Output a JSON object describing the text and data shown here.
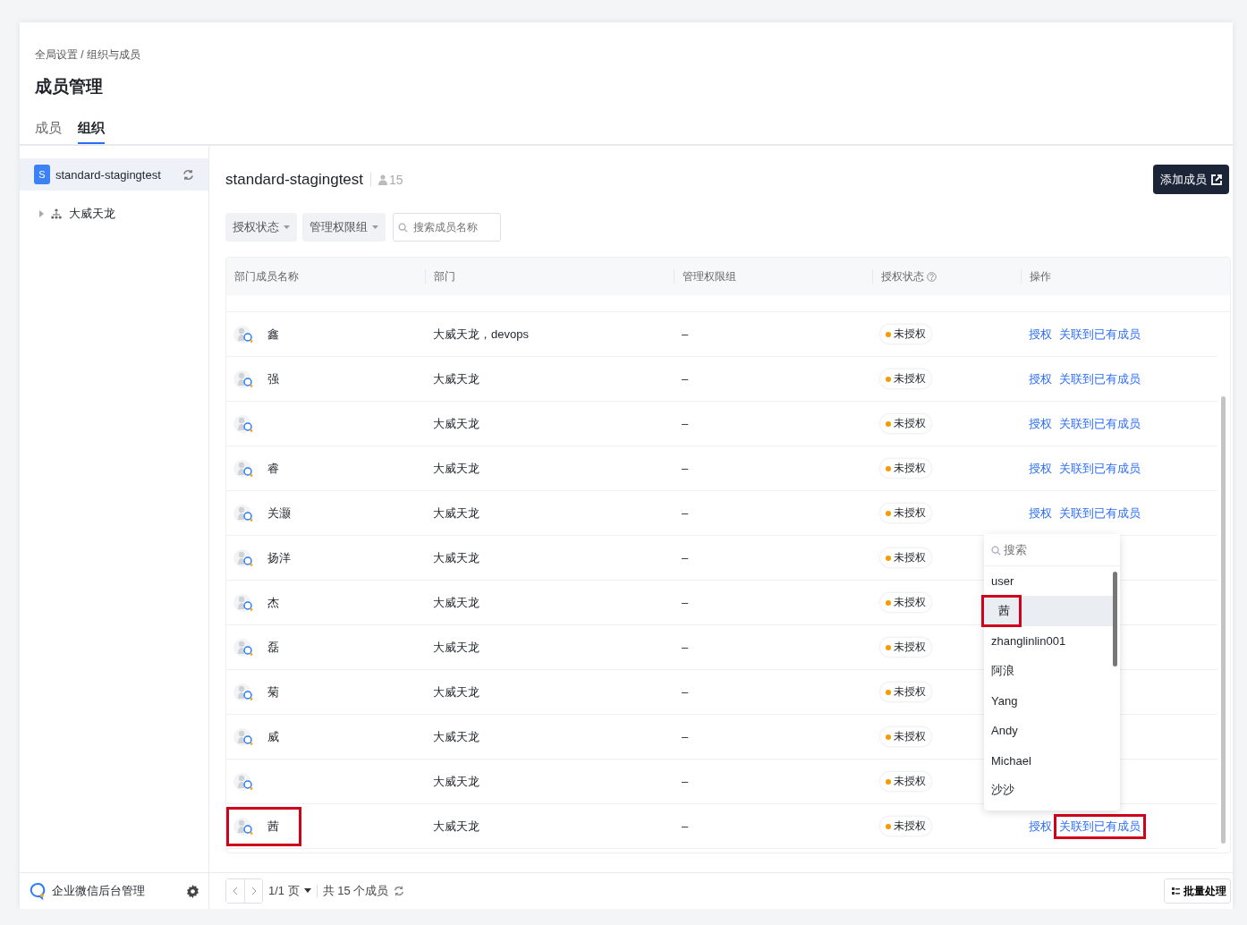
{
  "breadcrumb": "全局设置 / 组织与成员",
  "title": "成员管理",
  "tabs": [
    {
      "label": "成员",
      "selected": false
    },
    {
      "label": "组织",
      "selected": true
    }
  ],
  "sidebar": {
    "org": {
      "badge": "S",
      "name": "standard-stagingtest",
      "selected": true
    },
    "tree": [
      {
        "label": "大威天龙",
        "expanded": false
      }
    ],
    "footer_label": "企业微信后台管理"
  },
  "panel": {
    "title": "standard-stagingtest",
    "member_count": "15",
    "add_button": "添加成员",
    "filters": [
      {
        "label": "授权状态"
      },
      {
        "label": "管理权限组"
      }
    ],
    "search": {
      "placeholder": "搜索成员名称"
    }
  },
  "table": {
    "columns": [
      {
        "label": "部门成员名称",
        "help": false
      },
      {
        "label": "部门",
        "help": false
      },
      {
        "label": "管理权限组",
        "help": false
      },
      {
        "label": "授权状态",
        "help": true
      },
      {
        "label": "操作",
        "help": false
      }
    ],
    "rows": [
      {
        "name": "鑫",
        "department": "大威天龙，devops",
        "role": "–",
        "status": "未授权",
        "actions": [
          "授权",
          "关联到已有成员"
        ],
        "highlight_name": false,
        "highlight_action": false
      },
      {
        "name": "强",
        "department": "大威天龙",
        "role": "–",
        "status": "未授权",
        "actions": [
          "授权",
          "关联到已有成员"
        ],
        "highlight_name": false,
        "highlight_action": false
      },
      {
        "department": "大威天龙",
        "role": "–",
        "status": "未授权",
        "actions": [
          "授权",
          "关联到已有成员"
        ],
        "highlight_name": false,
        "highlight_action": false
      },
      {
        "name": "睿",
        "department": "大威天龙",
        "role": "–",
        "status": "未授权",
        "actions": [
          "授权",
          "关联到已有成员"
        ],
        "highlight_name": false,
        "highlight_action": false
      },
      {
        "name": "关灏",
        "department": "大威天龙",
        "role": "–",
        "status": "未授权",
        "actions": [
          "授权",
          "关联到已有成员"
        ],
        "highlight_name": false,
        "highlight_action": false
      },
      {
        "name": "扬洋",
        "department": "大威天龙",
        "role": "–",
        "status": "未授权",
        "highlight_name": false
      },
      {
        "name": "杰",
        "department": "大威天龙",
        "role": "–",
        "status": "未授权",
        "highlight_name": false
      },
      {
        "name": "磊",
        "department": "大威天龙",
        "role": "–",
        "status": "未授权",
        "highlight_name": false
      },
      {
        "name": "菊",
        "department": "大威天龙",
        "role": "–",
        "status": "未授权",
        "highlight_name": false
      },
      {
        "name": "威",
        "department": "大威天龙",
        "role": "–",
        "status": "未授权",
        "highlight_name": false
      },
      {
        "department": "大威天龙",
        "role": "–",
        "status": "未授权",
        "highlight_name": false
      },
      {
        "name": "茜",
        "department": "大威天龙",
        "role": "–",
        "status": "未授权",
        "actions": [
          "授权",
          "关联到已有成员"
        ],
        "highlight_name": true,
        "highlight_action": true
      }
    ]
  },
  "dropdown": {
    "placeholder": "搜索",
    "items": [
      {
        "label": "user",
        "hovered": false,
        "highlighted": false
      },
      {
        "label": "茜",
        "hovered": true,
        "highlighted": true
      },
      {
        "label": "zhanglinlin001",
        "hovered": false,
        "highlighted": false
      },
      {
        "label": "阿浪",
        "hovered": false,
        "highlighted": false
      },
      {
        "label": "Yang",
        "hovered": false,
        "highlighted": false
      },
      {
        "label": "Andy",
        "hovered": false,
        "highlighted": false
      },
      {
        "label": "Michael",
        "hovered": false,
        "highlighted": false
      },
      {
        "label": "沙沙",
        "hovered": false,
        "highlighted": false
      }
    ]
  },
  "footer": {
    "page": "1/1 页",
    "total": "共 15 个成员",
    "batch_button": "批量处理"
  }
}
